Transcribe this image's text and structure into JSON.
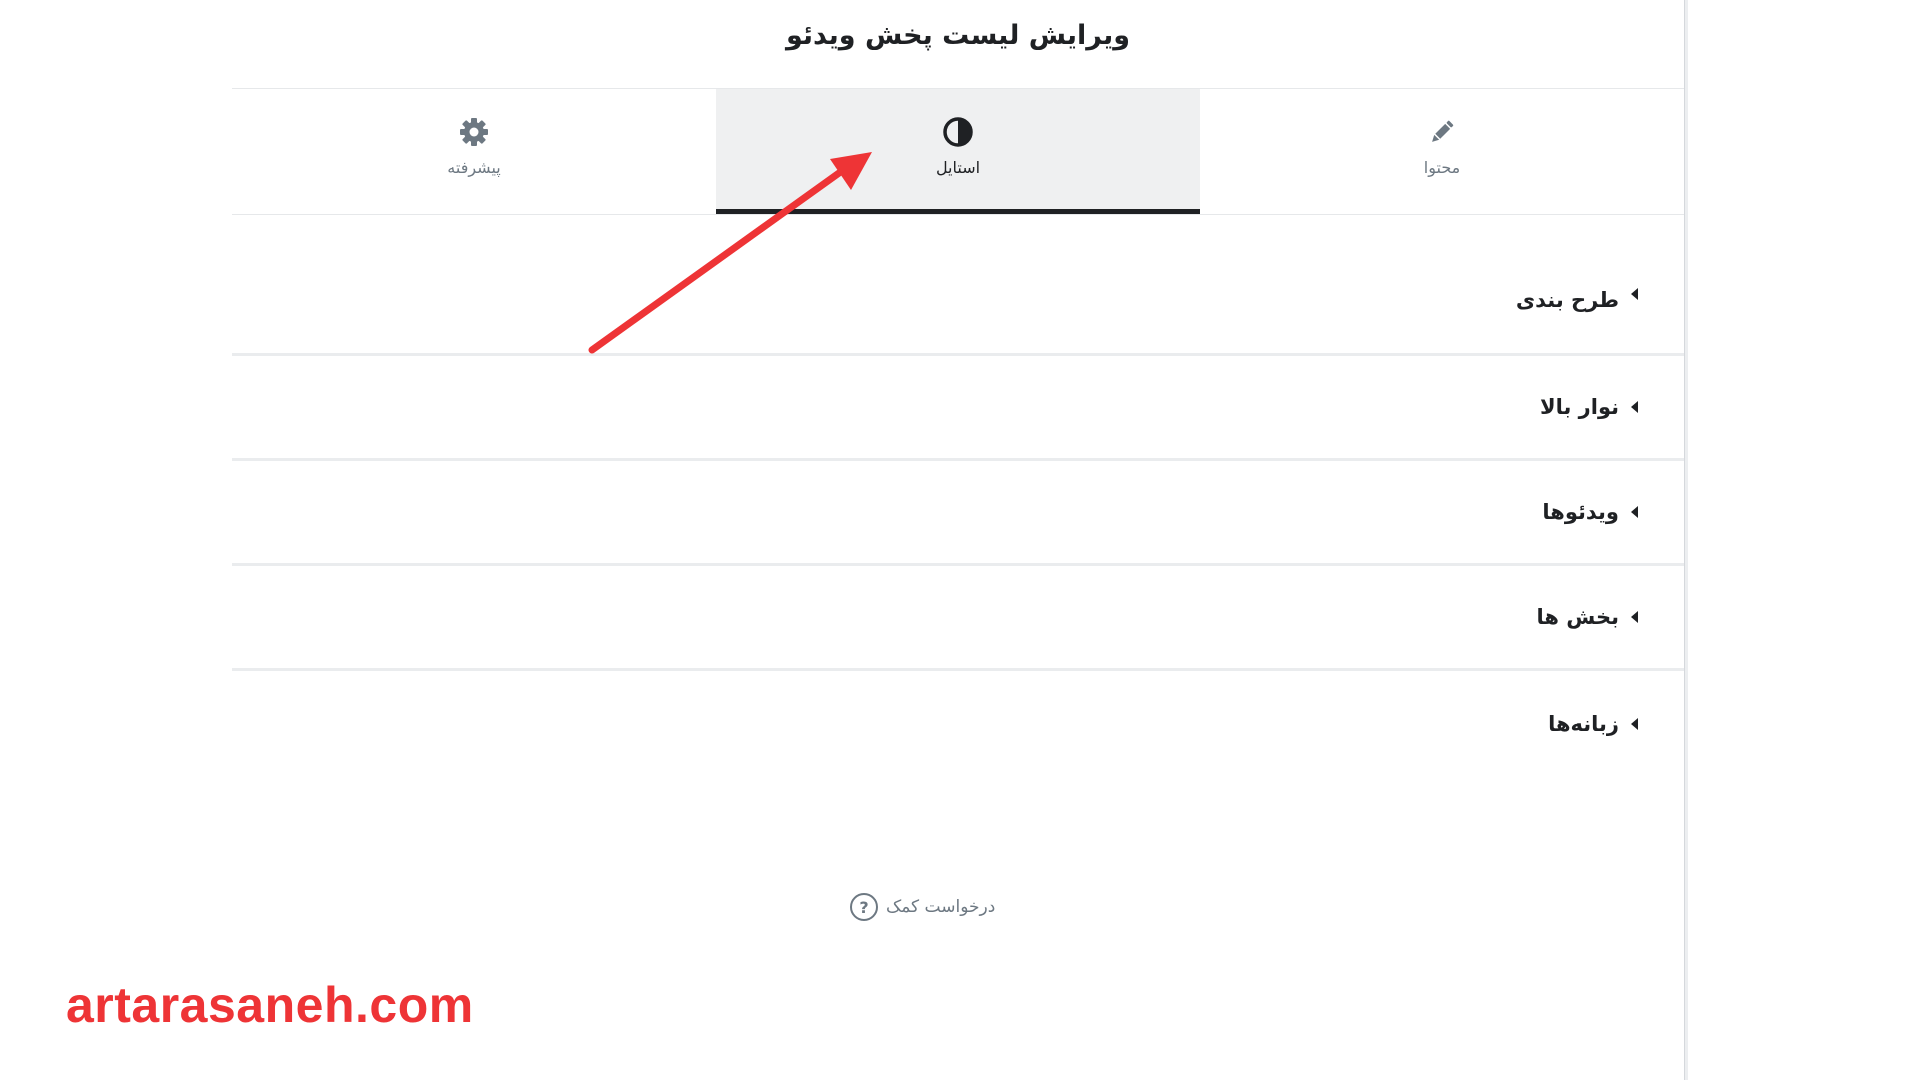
{
  "panel": {
    "title": "ویرایش لیست پخش ویدئو"
  },
  "tabs": [
    {
      "label": "محتوا",
      "icon": "pencil-icon",
      "active": false
    },
    {
      "label": "استایل",
      "icon": "contrast-icon",
      "active": true
    },
    {
      "label": "پیشرفته",
      "icon": "gear-icon",
      "active": false
    }
  ],
  "sections": [
    {
      "label": "طرح بندی"
    },
    {
      "label": "نوار بالا"
    },
    {
      "label": "ویدئوها"
    },
    {
      "label": "بخش ها"
    },
    {
      "label": "زبانه‌ها"
    }
  ],
  "help": {
    "label": "درخواست کمک",
    "icon": "question-circle-icon"
  },
  "watermark": {
    "text": "artarasaneh.com"
  },
  "colors": {
    "annotation_arrow": "#ee3436",
    "watermark": "#ee3436",
    "active_tab_bg": "#eff0f1",
    "active_tab_underline": "#1f2124",
    "muted_text": "#6d7882"
  }
}
